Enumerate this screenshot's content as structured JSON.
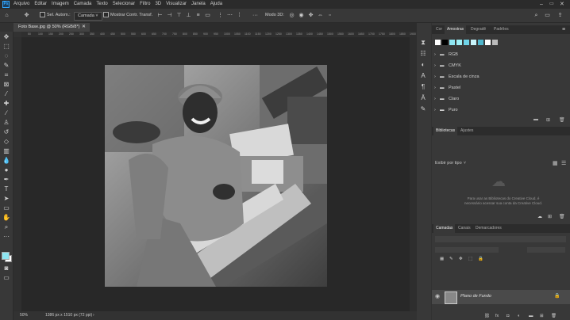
{
  "menubar": {
    "items": [
      "Arquivo",
      "Editar",
      "Imagem",
      "Camada",
      "Texto",
      "Selecionar",
      "Filtro",
      "3D",
      "Visualizar",
      "Janela",
      "Ajuda"
    ]
  },
  "options_bar": {
    "auto_select_label": "Sel. Autom.:",
    "auto_select_value": "Camada",
    "show_transform_label": "Mostrar Contr. Transf.",
    "mode_3d_label": "Modo 3D:"
  },
  "document": {
    "tab_title": "Foto Base.jpg @ 50% (RGB/8*)",
    "zoom": "50%",
    "doc_info": "1386 px x 1510 px (72 ppi)"
  },
  "ruler_top_labels": [
    "50",
    "100",
    "150",
    "200",
    "250",
    "300",
    "350",
    "400",
    "450",
    "500",
    "550",
    "600",
    "650",
    "700",
    "750",
    "800",
    "850",
    "900",
    "950",
    "1000",
    "1050",
    "1100",
    "1150",
    "1200",
    "1250",
    "1300",
    "1350",
    "1400",
    "1450",
    "1500",
    "1550",
    "1600",
    "1650",
    "1700",
    "1750",
    "1800",
    "1850",
    "1900",
    "1950"
  ],
  "swatches_panel": {
    "tabs": [
      "Cor",
      "Amostras",
      "Degradê",
      "Padrões"
    ],
    "active_tab": "Amostras",
    "swatch_colors": [
      "#ffffff",
      "#000000",
      "#8ee6f2",
      "#9ff0f6",
      "#6fd4e8",
      "#c8f4fa",
      "#4fb6cc",
      "#ffffff",
      "#bbbbbb"
    ],
    "folders": [
      "RGB",
      "CMYK",
      "Escala de cinza",
      "Pastel",
      "Claro",
      "Puro"
    ]
  },
  "libraries_panel": {
    "tabs": [
      "Bibliotecas",
      "Ajustes"
    ],
    "active_tab": "Bibliotecas",
    "filter_label": "Exibir por tipo",
    "empty_message": "Para usar as Bibliotecas do Creative Cloud, é necessário acessar sua conta da Creative Cloud."
  },
  "layers_panel": {
    "tabs": [
      "Camadas",
      "Canais",
      "Demarcadores"
    ],
    "active_tab": "Camadas",
    "layers": [
      {
        "name": "Plano de Fundo",
        "visible": true,
        "locked": true
      }
    ]
  },
  "colors": {
    "foreground": "#8ee6f2",
    "background": "#ffffff",
    "accent": "#4a8fe7"
  }
}
